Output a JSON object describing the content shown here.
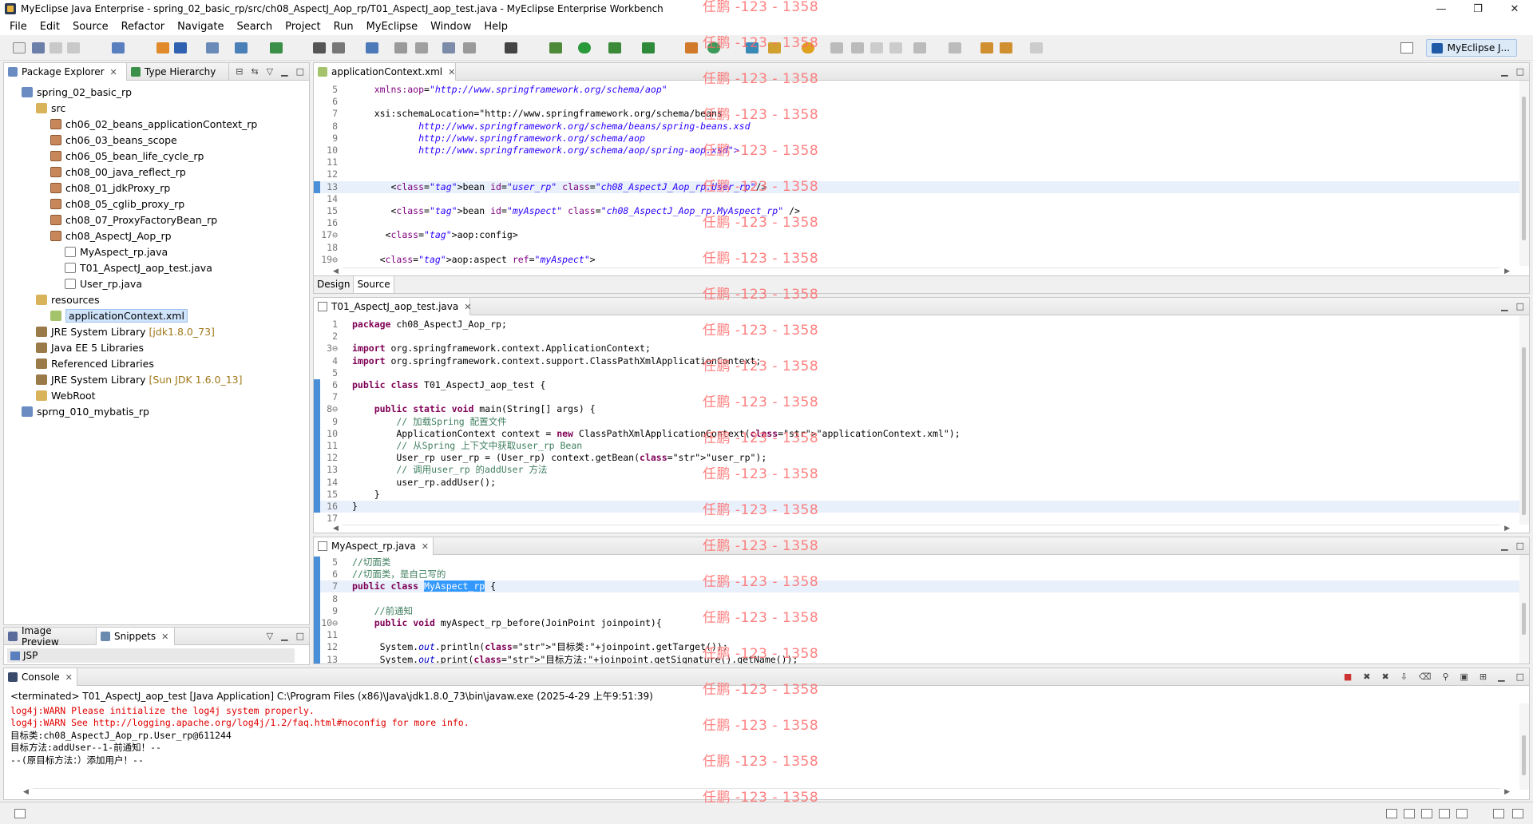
{
  "window": {
    "title": "MyEclipse Java Enterprise - spring_02_basic_rp/src/ch08_AspectJ_Aop_rp/T01_AspectJ_aop_test.java - MyEclipse Enterprise Workbench",
    "minimize": "—",
    "maximize": "❐",
    "close": "✕"
  },
  "menu": [
    "File",
    "Edit",
    "Source",
    "Refactor",
    "Navigate",
    "Search",
    "Project",
    "Run",
    "MyEclipse",
    "Window",
    "Help"
  ],
  "toolbar": {
    "perspective_label": "MyEclipse J..."
  },
  "explorer": {
    "tab_package": "Package Explorer",
    "tab_hierarchy": "Type Hierarchy",
    "items": [
      {
        "label": "spring_02_basic_rp",
        "icon": "project-icon"
      },
      {
        "label": "src",
        "icon": "source-folder-icon"
      },
      {
        "label": "ch06_02_beans_applicationContext_rp",
        "icon": "package-icon"
      },
      {
        "label": "ch06_03_beans_scope",
        "icon": "package-icon"
      },
      {
        "label": "ch06_05_bean_life_cycle_rp",
        "icon": "package-icon"
      },
      {
        "label": "ch08_00_java_reflect_rp",
        "icon": "package-icon"
      },
      {
        "label": "ch08_01_jdkProxy_rp",
        "icon": "package-icon"
      },
      {
        "label": "ch08_05_cglib_proxy_rp",
        "icon": "package-icon"
      },
      {
        "label": "ch08_07_ProxyFactoryBean_rp",
        "icon": "package-icon"
      },
      {
        "label": "ch08_AspectJ_Aop_rp",
        "icon": "package-icon"
      },
      {
        "label": "MyAspect_rp.java",
        "icon": "java-file-icon"
      },
      {
        "label": "T01_AspectJ_aop_test.java",
        "icon": "java-file-icon"
      },
      {
        "label": "User_rp.java",
        "icon": "java-file-icon"
      },
      {
        "label": "resources",
        "icon": "source-folder-icon"
      },
      {
        "label": "applicationContext.xml",
        "icon": "xml-file-icon"
      },
      {
        "label": "JRE System Library",
        "extra": "[jdk1.8.0_73]",
        "icon": "library-icon"
      },
      {
        "label": "Java EE 5 Libraries",
        "icon": "library-icon"
      },
      {
        "label": "Referenced Libraries",
        "icon": "library-icon"
      },
      {
        "label": "JRE System Library",
        "extra": "[Sun JDK 1.6.0_13]",
        "icon": "library-icon"
      },
      {
        "label": "WebRoot",
        "icon": "folder-icon"
      },
      {
        "label": "sprng_010_mybatis_rp",
        "icon": "project-icon"
      }
    ]
  },
  "bottom_left": {
    "tab_image": "Image Preview",
    "tab_snippets": "Snippets",
    "jsp_label": "JSP"
  },
  "xml_editor": {
    "tab": "applicationContext.xml",
    "design_tab": "Design",
    "source_tab": "Source",
    "lines": [
      {
        "n": "5",
        "text": "    xmlns:aop=\"http://www.springframework.org/schema/aop\""
      },
      {
        "n": "6",
        "text": ""
      },
      {
        "n": "7",
        "text": "    xsi:schemaLocation=\"http://www.springframework.org/schema/beans"
      },
      {
        "n": "8",
        "text": "            http://www.springframework.org/schema/beans/spring-beans.xsd"
      },
      {
        "n": "9",
        "text": "            http://www.springframework.org/schema/aop"
      },
      {
        "n": "10",
        "text": "            http://www.springframework.org/schema/aop/spring-aop.xsd\">"
      },
      {
        "n": "11",
        "text": ""
      },
      {
        "n": "12",
        "text": ""
      },
      {
        "n": "13",
        "text": "       <bean id=\"user_rp\" class=\"ch08_AspectJ_Aop_rp.User_rp\"/>"
      },
      {
        "n": "14",
        "text": ""
      },
      {
        "n": "15",
        "text": "       <bean id=\"myAspect\" class=\"ch08_AspectJ_Aop_rp.MyAspect_rp\" />"
      },
      {
        "n": "16",
        "text": ""
      },
      {
        "n": "17⊖",
        "text": "      <aop:config>"
      },
      {
        "n": "18",
        "text": ""
      },
      {
        "n": "19⊖",
        "text": "     <aop:aspect ref=\"myAspect\">"
      }
    ]
  },
  "test_editor": {
    "tab": "T01_AspectJ_aop_test.java",
    "lines": [
      {
        "n": "1",
        "text": "package ch08_AspectJ_Aop_rp;"
      },
      {
        "n": "2",
        "text": ""
      },
      {
        "n": "3⊖",
        "text": "import org.springframework.context.ApplicationContext;"
      },
      {
        "n": "4",
        "text": "import org.springframework.context.support.ClassPathXmlApplicationContext;"
      },
      {
        "n": "5",
        "text": ""
      },
      {
        "n": "6",
        "text": "public class T01_AspectJ_aop_test {"
      },
      {
        "n": "7",
        "text": ""
      },
      {
        "n": "8⊖",
        "text": "    public static void main(String[] args) {"
      },
      {
        "n": "9",
        "text": "        // 加载Spring 配置文件"
      },
      {
        "n": "10",
        "text": "        ApplicationContext context = new ClassPathXmlApplicationContext(\"applicationContext.xml\");"
      },
      {
        "n": "11",
        "text": "        // 从Spring 上下文中获取user_rp Bean"
      },
      {
        "n": "12",
        "text": "        User_rp user_rp = (User_rp) context.getBean(\"user_rp\");"
      },
      {
        "n": "13",
        "text": "        // 调用user_rp 的addUser 方法"
      },
      {
        "n": "14",
        "text": "        user_rp.addUser();"
      },
      {
        "n": "15",
        "text": "    }"
      },
      {
        "n": "16",
        "text": "}"
      },
      {
        "n": "17",
        "text": ""
      }
    ]
  },
  "aspect_editor": {
    "tab": "MyAspect_rp.java",
    "lines": [
      {
        "n": "5",
        "text": "//切面类"
      },
      {
        "n": "6",
        "text": "//切面类，是自己写的"
      },
      {
        "n": "7",
        "pre": "public class ",
        "sel": "MyAspect_rp",
        "post": " {"
      },
      {
        "n": "8",
        "text": ""
      },
      {
        "n": "9",
        "text": "    //前通知"
      },
      {
        "n": "10⊖",
        "text": "    public void myAspect_rp_before(JoinPoint joinpoint){"
      },
      {
        "n": "11",
        "text": ""
      },
      {
        "n": "12",
        "text": "     System.out.println(\"目标类:\"+joinpoint.getTarget());"
      },
      {
        "n": "13",
        "text": "     System.out.print(\"目标方法:\"+joinpoint.getSignature().getName());"
      }
    ]
  },
  "console": {
    "tab": "Console",
    "header": "<terminated> T01_AspectJ_aop_test [Java Application] C:\\Program Files (x86)\\Java\\jdk1.8.0_73\\bin\\javaw.exe (2025-4-29 上午9:51:39)",
    "lines": [
      {
        "text": "log4j:WARN Please initialize the log4j system properly.",
        "color": "red"
      },
      {
        "text": "log4j:WARN See http://logging.apache.org/log4j/1.2/faq.html#noconfig for more info.",
        "color": "red"
      },
      {
        "text": "目标类:ch08_AspectJ_Aop_rp.User_rp@611244",
        "color": "black"
      },
      {
        "text": "目标方法:addUser--1-前通知！--",
        "color": "black"
      },
      {
        "text": "--(原目标方法：）添加用户！--",
        "color": "black"
      }
    ]
  },
  "watermark": "任鹏 -123 - 1358",
  "colors": {
    "accent": "#4a90d9",
    "selection": "#3399ff",
    "watermark": "#ff6b6b"
  }
}
